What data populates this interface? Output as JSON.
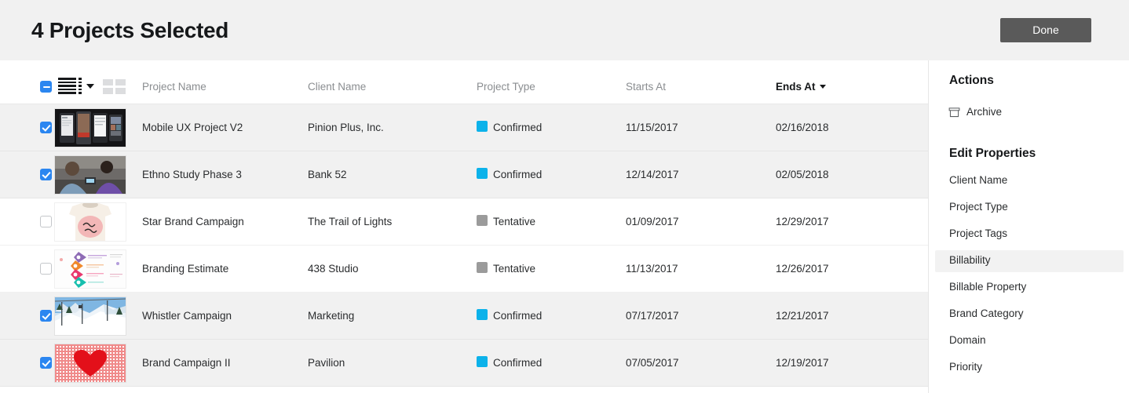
{
  "header": {
    "title": "4 Projects Selected",
    "done_label": "Done"
  },
  "toolbar": {
    "select_all_state": "indeterminate",
    "list_view_icon": "list-view-icon",
    "grid_view_icon": "grid-view-icon",
    "view_dropdown_icon": "chevron-down-icon"
  },
  "table": {
    "columns": [
      {
        "key": "project_name",
        "label": "Project Name",
        "sorted": false
      },
      {
        "key": "client_name",
        "label": "Client Name",
        "sorted": false
      },
      {
        "key": "project_type",
        "label": "Project Type",
        "sorted": false
      },
      {
        "key": "starts_at",
        "label": "Starts At",
        "sorted": false
      },
      {
        "key": "ends_at",
        "label": "Ends At",
        "sorted": true
      }
    ],
    "rows": [
      {
        "selected": true,
        "project_name": "Mobile UX Project V2",
        "client_name": "Pinion Plus, Inc.",
        "project_type": "Confirmed",
        "type_color": "#0cb2ea",
        "starts_at": "11/15/2017",
        "ends_at": "02/16/2018",
        "thumb": "phone-mockups-thumbnail"
      },
      {
        "selected": true,
        "project_name": "Ethno Study Phase 3",
        "client_name": "Bank 52",
        "project_type": "Confirmed",
        "type_color": "#0cb2ea",
        "starts_at": "12/14/2017",
        "ends_at": "02/05/2018",
        "thumb": "research-session-photo-thumbnail"
      },
      {
        "selected": false,
        "project_name": "Star Brand Campaign",
        "client_name": "The Trail of Lights",
        "project_type": "Tentative",
        "type_color": "#9b9b9b",
        "starts_at": "01/09/2017",
        "ends_at": "12/29/2017",
        "thumb": "hello-love-tshirt-thumbnail"
      },
      {
        "selected": false,
        "project_name": "Branding Estimate",
        "client_name": "438 Studio",
        "project_type": "Tentative",
        "type_color": "#9b9b9b",
        "starts_at": "11/13/2017",
        "ends_at": "12/26/2017",
        "thumb": "infographic-chevrons-thumbnail"
      },
      {
        "selected": true,
        "project_name": "Whistler Campaign",
        "client_name": "Marketing",
        "project_type": "Confirmed",
        "type_color": "#0cb2ea",
        "starts_at": "07/17/2017",
        "ends_at": "12/21/2017",
        "thumb": "ski-slope-photo-thumbnail"
      },
      {
        "selected": true,
        "project_name": "Brand Campaign II",
        "client_name": "Pavilion",
        "project_type": "Confirmed",
        "type_color": "#0cb2ea",
        "starts_at": "07/05/2017",
        "ends_at": "12/19/2017",
        "thumb": "red-heart-gingham-thumbnail"
      }
    ]
  },
  "sidebar": {
    "actions_title": "Actions",
    "actions": [
      {
        "label": "Archive",
        "icon": "archive-box-icon"
      }
    ],
    "properties_title": "Edit Properties",
    "properties": [
      {
        "label": "Client Name",
        "active": false
      },
      {
        "label": "Project Type",
        "active": false
      },
      {
        "label": "Project Tags",
        "active": false
      },
      {
        "label": "Billability",
        "active": true
      },
      {
        "label": "Billable Property",
        "active": false
      },
      {
        "label": "Brand Category",
        "active": false
      },
      {
        "label": "Domain",
        "active": false
      },
      {
        "label": "Priority",
        "active": false
      }
    ]
  },
  "colors": {
    "confirmed": "#0cb2ea",
    "tentative": "#9b9b9b",
    "checkbox_accent": "#2b86f0",
    "done_button_bg": "#5a5a5a",
    "topbar_bg": "#f1f1f1",
    "selected_row_bg": "#f1f1f1",
    "active_property_bg": "#f2f2f2"
  }
}
